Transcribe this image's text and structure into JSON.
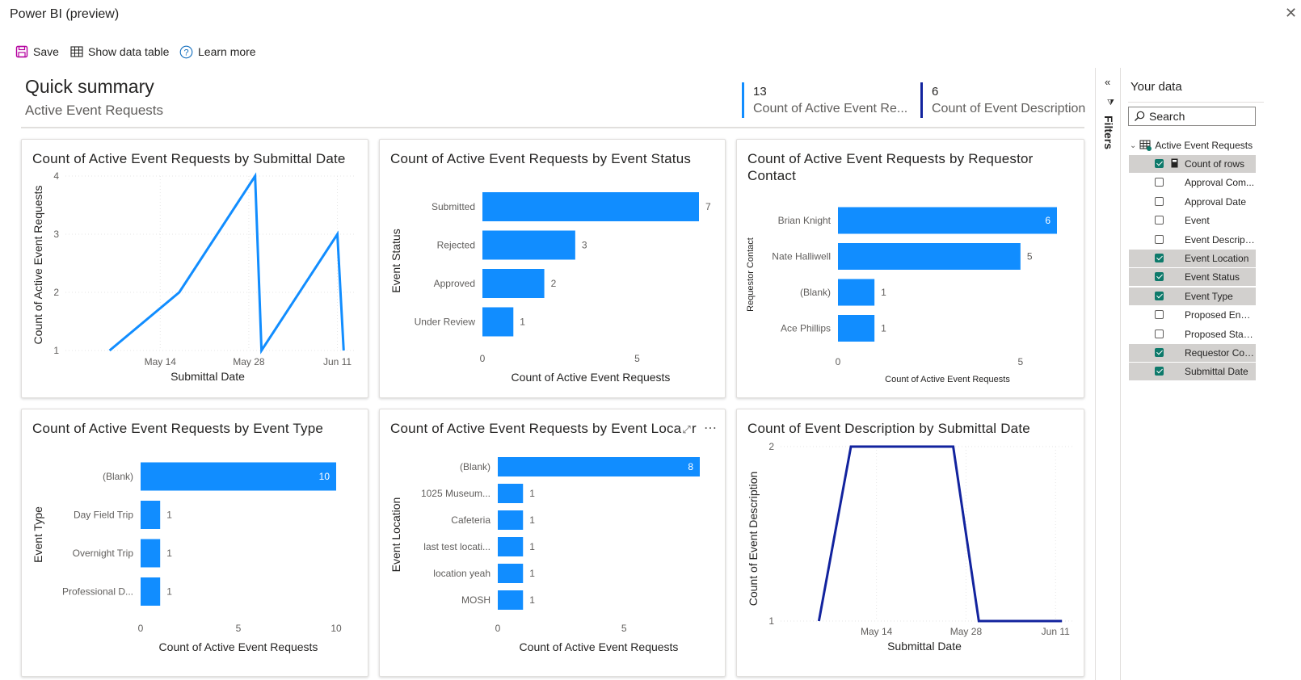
{
  "app": {
    "title": "Power BI (preview)"
  },
  "toolbar": {
    "save_label": "Save",
    "show_table_label": "Show data table",
    "learn_more_label": "Learn more"
  },
  "summary": {
    "title": "Quick summary",
    "subtitle": "Active Event Requests",
    "kpis": [
      {
        "value": "13",
        "label": "Count of Active Event Re...",
        "color": "#118dff"
      },
      {
        "value": "6",
        "label": "Count of Event Description",
        "color": "#12239e"
      }
    ]
  },
  "colors": {
    "bar": "#118dff",
    "line1": "#118dff",
    "line2": "#12239e",
    "checked": "#0e7a6b"
  },
  "chart_data": [
    {
      "type": "line",
      "title": "Count of Active Event Requests by Submittal Date",
      "xlabel": "Submittal Date",
      "ylabel": "Count of Active Event Requests",
      "x_ticks": [
        "May 14",
        "May 28",
        "Jun 11"
      ],
      "y_ticks": [
        "1",
        "2",
        "3",
        "4"
      ],
      "ylim": [
        1,
        4
      ],
      "series": [
        {
          "x": [
            "2023-05-06",
            "2023-05-17",
            "2023-05-29",
            "2023-05-30",
            "2023-06-11",
            "2023-06-12"
          ],
          "values": [
            1,
            2,
            4,
            1,
            3,
            1
          ]
        }
      ]
    },
    {
      "type": "bar",
      "title": "Count of Active Event Requests by Event Status",
      "xlabel": "Count of Active Event Requests",
      "ylabel": "Event Status",
      "categories": [
        "Submitted",
        "Rejected",
        "Approved",
        "Under Review"
      ],
      "values": [
        7,
        3,
        2,
        1
      ],
      "x_ticks": [
        "0",
        "5"
      ],
      "xlim": [
        0,
        7
      ]
    },
    {
      "type": "bar",
      "title": "Count of Active Event Requests by Requestor Contact",
      "xlabel": "Count of Active Event Requests",
      "ylabel": "Requestor Contact",
      "categories": [
        "Brian Knight",
        "Nate Halliwell",
        "(Blank)",
        "Ace Phillips"
      ],
      "values": [
        6,
        5,
        1,
        1
      ],
      "x_ticks": [
        "0",
        "5"
      ],
      "xlim": [
        0,
        6
      ]
    },
    {
      "type": "bar",
      "title": "Count of Active Event Requests by Event Type",
      "xlabel": "Count of Active Event Requests",
      "ylabel": "Event Type",
      "categories": [
        "(Blank)",
        "Day Field Trip",
        "Overnight Trip",
        "Professional D..."
      ],
      "values": [
        10,
        1,
        1,
        1
      ],
      "x_ticks": [
        "0",
        "5",
        "10"
      ],
      "xlim": [
        0,
        10
      ]
    },
    {
      "type": "bar",
      "title": "Count of Active Event Requests by Event Loca",
      "title_suffix": "r",
      "xlabel": "Count of Active Event Requests",
      "ylabel": "Event Location",
      "categories": [
        "(Blank)",
        "1025 Museum...",
        "Cafeteria",
        "last test locati...",
        "location yeah",
        "MOSH"
      ],
      "values": [
        8,
        1,
        1,
        1,
        1,
        1
      ],
      "x_ticks": [
        "0",
        "5"
      ],
      "xlim": [
        0,
        8
      ]
    },
    {
      "type": "line",
      "title": "Count of Event Description by Submittal Date",
      "xlabel": "Submittal Date",
      "ylabel": "Count of Event Description",
      "x_ticks": [
        "May 14",
        "May 28",
        "Jun 11"
      ],
      "y_ticks": [
        "1",
        "2"
      ],
      "ylim": [
        1,
        2
      ],
      "series": [
        {
          "x": [
            "2023-05-05",
            "2023-05-10",
            "2023-05-26",
            "2023-05-30",
            "2023-06-12"
          ],
          "values": [
            1,
            2,
            2,
            1,
            1
          ]
        }
      ]
    }
  ],
  "filters": {
    "label": "Filters"
  },
  "data_pane": {
    "title": "Your data",
    "search_placeholder": "Search",
    "table": "Active Event Requests",
    "fields": [
      {
        "label": "Count of rows",
        "checked": true,
        "calc": true
      },
      {
        "label": "Approval Com...",
        "checked": false
      },
      {
        "label": "Approval Date",
        "checked": false
      },
      {
        "label": "Event",
        "checked": false
      },
      {
        "label": "Event Descripti...",
        "checked": false
      },
      {
        "label": "Event Location",
        "checked": true
      },
      {
        "label": "Event Status",
        "checked": true
      },
      {
        "label": "Event Type",
        "checked": true
      },
      {
        "label": "Proposed End ...",
        "checked": false
      },
      {
        "label": "Proposed Start ...",
        "checked": false
      },
      {
        "label": "Requestor Cont...",
        "checked": true
      },
      {
        "label": "Submittal Date",
        "checked": true
      }
    ]
  }
}
